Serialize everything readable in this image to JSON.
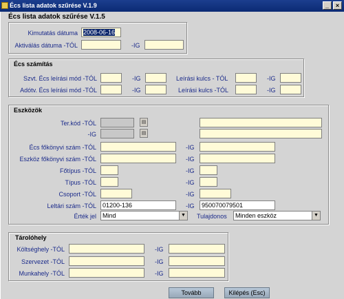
{
  "window": {
    "title": "Écs lista adatok szűrése V.1.9"
  },
  "header": {
    "caption": "Écs lista adatok szűrése V.1.5"
  },
  "top": {
    "kimutatas_label": "Kimutatás dátuma",
    "kimutatas_value": "2008-06-16",
    "aktivalas_label": "Aktiválás dátuma -TÓL",
    "ig_label": "-IG"
  },
  "ecs_szamitas": {
    "title": "Écs számítás",
    "szvt_label": "Szvt. Écs leírási mód -TÓL",
    "adotv_label": "Adótv. Écs leírási mód -TÓL",
    "leirasi_kulcs_label": "Leírási kulcs - TÓL",
    "leirasi_kulcs2_label": "Leírási kulcs -TÓL",
    "ig_label": "-IG"
  },
  "eszkozok": {
    "title": "Eszközök",
    "ter_kod_label": "Ter.kód -TÓL",
    "ig_label": "-IG",
    "ecs_fokonyvi_label": "Écs főkönyvi szám -TÓL",
    "eszkoz_fokonyvi_label": "Eszköz főkönyvi szám -TÓL",
    "fotipus_label": "Főtípus -TÓL",
    "tipus_label": "Típus -TÓL",
    "csoport_label": "Csoport -TÓL",
    "leltari_label": "Leltári szám -TÓL",
    "leltari_tol_value": "01200-136",
    "leltari_ig_value": "950070079501",
    "ertek_jel_label": "Érték jel",
    "ertek_jel_value": "Mind",
    "tulajdonos_label": "Tulajdonos",
    "tulajdonos_value": "Minden eszköz"
  },
  "tarolohely": {
    "title": "Tárolóhely",
    "koltseghely_label": "Költséghely -TÓL",
    "szervezet_label": "Szervezet -TÓL",
    "munkahely_label": "Munkahely -TÓL",
    "ig_label": "-IG"
  },
  "buttons": {
    "tovabb": "Tovább",
    "kilepes": "Kilépés (Esc)"
  },
  "window_buttons": {
    "minimize": "_",
    "close": "×"
  },
  "glyphs": {
    "lov": "▤",
    "dropdown": "▼"
  },
  "colors": {
    "field_bg": "#fffbd8",
    "label": "#1a2a8a",
    "titlebar": "#0b2a74"
  }
}
